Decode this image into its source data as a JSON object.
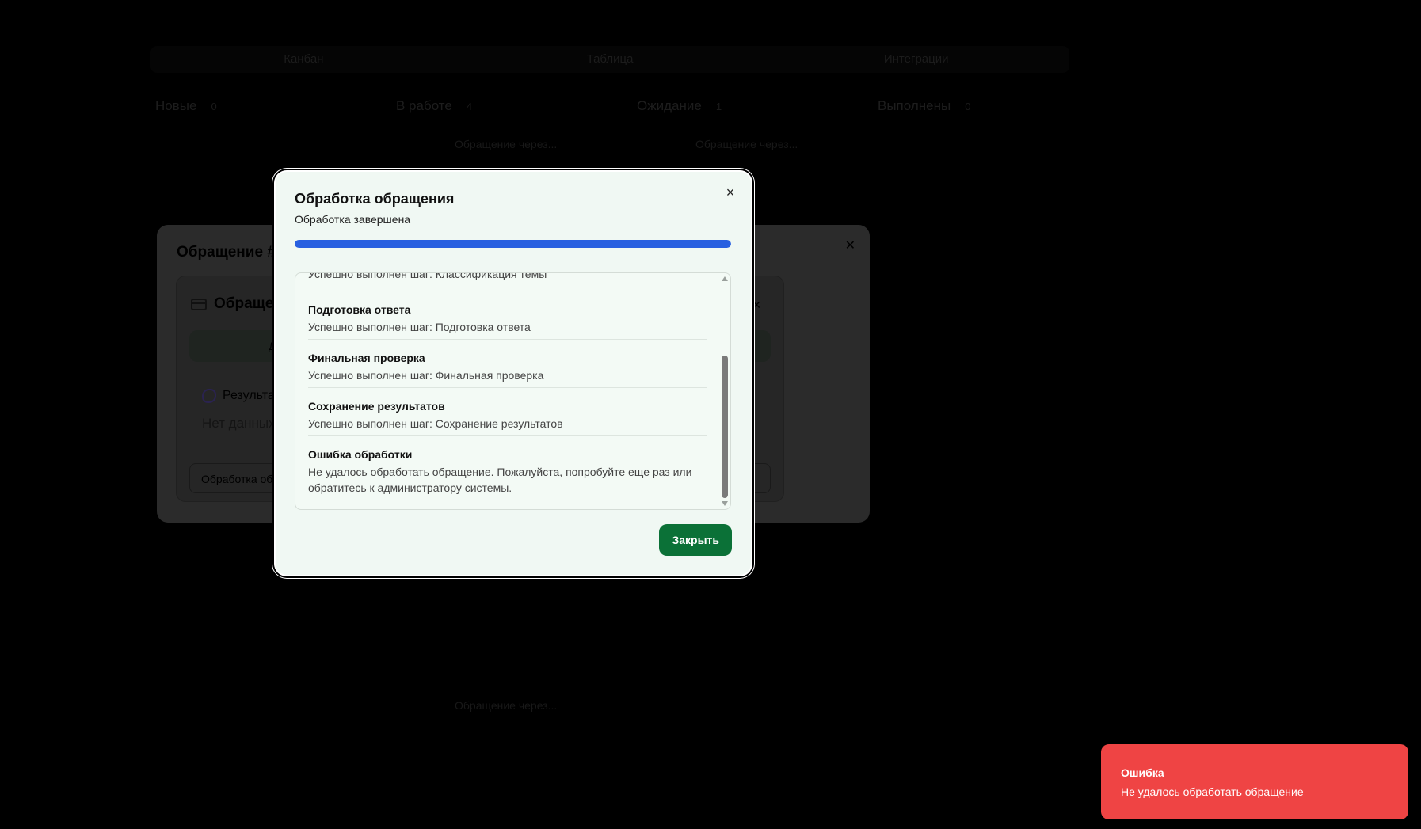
{
  "board": {
    "view_tabs": [
      "Канбан",
      "Таблица",
      "Интеграции"
    ],
    "columns": [
      {
        "name": "Новые",
        "count": "0"
      },
      {
        "name": "В работе",
        "count": "4"
      },
      {
        "name": "Ожидание",
        "count": "1"
      },
      {
        "name": "Выполнены",
        "count": "0"
      }
    ],
    "card_titles": [
      "Обращение через...",
      "Обращение через...",
      "Обращение через..."
    ]
  },
  "ticket_modal": {
    "title": "Обращение #3",
    "inner_title": "Обращение",
    "first_tab": "Д",
    "result_label": "Результат",
    "no_data": "Нет данных",
    "processing_field": "Обработка об"
  },
  "dialog": {
    "title": "Обработка обращения",
    "subtitle": "Обработка завершена",
    "progress": 1.0,
    "log": [
      {
        "title": "",
        "description": "Успешно выполнен шаг: Классификация темы"
      },
      {
        "title": "Подготовка ответа",
        "description": "Успешно выполнен шаг: Подготовка ответа"
      },
      {
        "title": "Финальная проверка",
        "description": "Успешно выполнен шаг: Финальная проверка"
      },
      {
        "title": "Сохранение результатов",
        "description": "Успешно выполнен шаг: Сохранение результатов"
      },
      {
        "title": "Ошибка обработки",
        "description": "Не удалось обработать обращение. Пожалуйста, попробуйте еще раз или обратитесь к администратору системы."
      }
    ],
    "close_label": "Закрыть",
    "close_icon": "×"
  },
  "toast": {
    "title": "Ошибка",
    "message": "Не удалось обработать обращение"
  },
  "colors": {
    "accent_button": "#0b7137",
    "progress": "#2860e0",
    "toast": "#ef4444"
  }
}
